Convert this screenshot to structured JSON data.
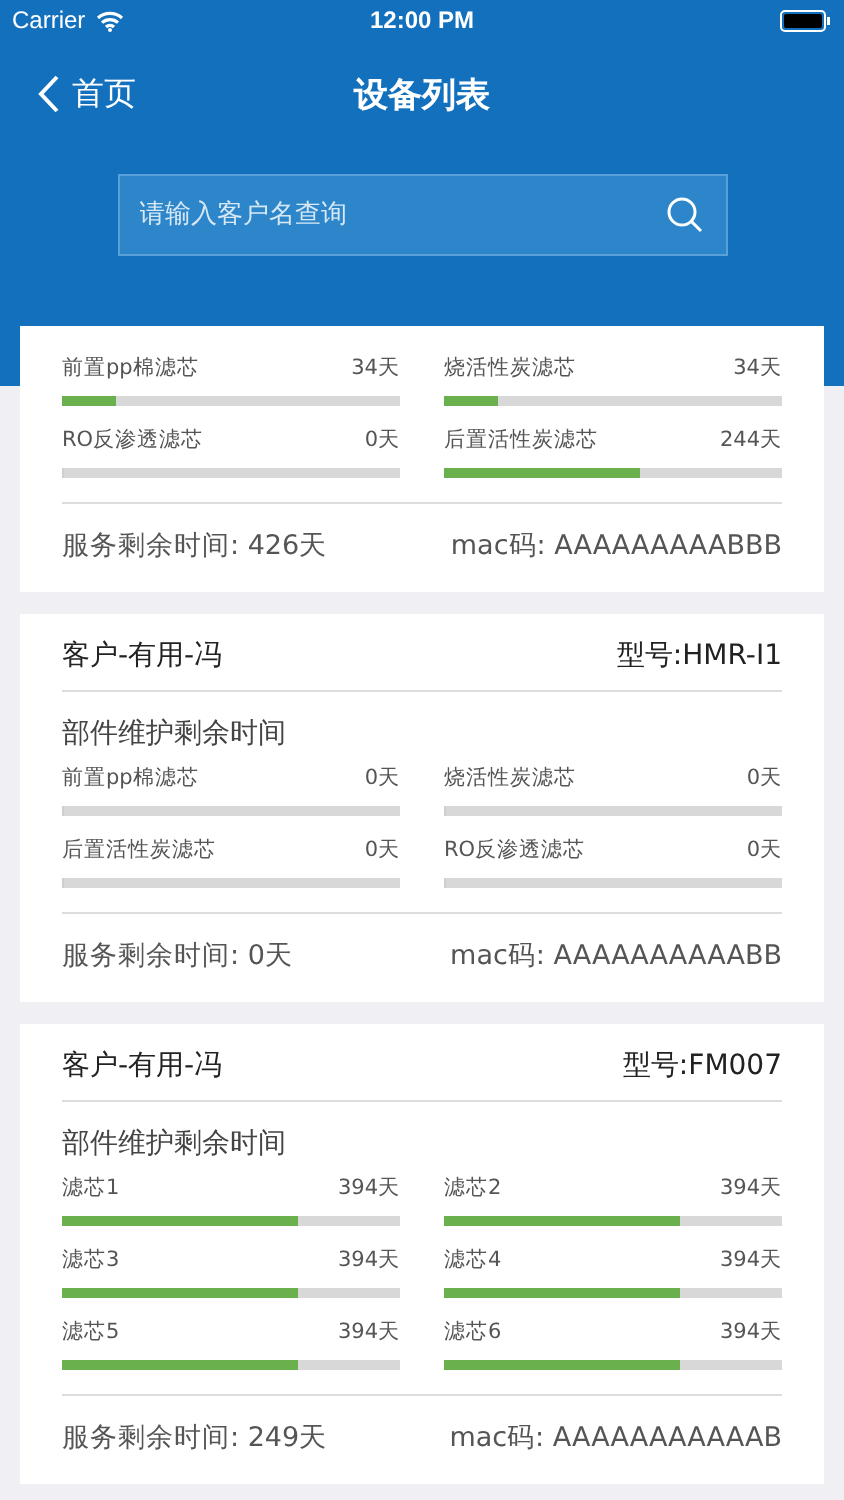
{
  "status_bar": {
    "carrier": "Carrier",
    "time": "12:00 PM"
  },
  "nav": {
    "back": "首页",
    "title": "设备列表"
  },
  "search": {
    "placeholder": "请输入客户名查询"
  },
  "devices": [
    {
      "filters": [
        {
          "name": "前置pp棉滤芯",
          "days": "34天",
          "level": 0.16
        },
        {
          "name": "烧活性炭滤芯",
          "days": "34天",
          "level": 0.16
        },
        {
          "name": "RO反渗透滤芯",
          "days": "0天",
          "level": 0
        },
        {
          "name": "后置活性炭滤芯",
          "days": "244天",
          "level": 0.58
        }
      ],
      "service": "服务剩余时间: 426天",
      "mac": "mac码: AAAAAAAAABBB"
    },
    {
      "customer": "客户-有用-冯",
      "model": "型号:HMR-I1",
      "section": "部件维护剩余时间",
      "filters": [
        {
          "name": "前置pp棉滤芯",
          "days": "0天",
          "level": 0
        },
        {
          "name": "烧活性炭滤芯",
          "days": "0天",
          "level": 0
        },
        {
          "name": "后置活性炭滤芯",
          "days": "0天",
          "level": 0
        },
        {
          "name": "RO反渗透滤芯",
          "days": "0天",
          "level": 0
        }
      ],
      "service": "服务剩余时间: 0天",
      "mac": "mac码: AAAAAAAAAABB"
    },
    {
      "customer": "客户-有用-冯",
      "model": "型号:FM007",
      "section": "部件维护剩余时间",
      "filters": [
        {
          "name": "滤芯1",
          "days": "394天",
          "level": 0.7
        },
        {
          "name": "滤芯2",
          "days": "394天",
          "level": 0.7
        },
        {
          "name": "滤芯3",
          "days": "394天",
          "level": 0.7
        },
        {
          "name": "滤芯4",
          "days": "394天",
          "level": 0.7
        },
        {
          "name": "滤芯5",
          "days": "394天",
          "level": 0.7
        },
        {
          "name": "滤芯6",
          "days": "394天",
          "level": 0.7
        }
      ],
      "service": "服务剩余时间: 249天",
      "mac": "mac码: AAAAAAAAAAAB"
    }
  ]
}
